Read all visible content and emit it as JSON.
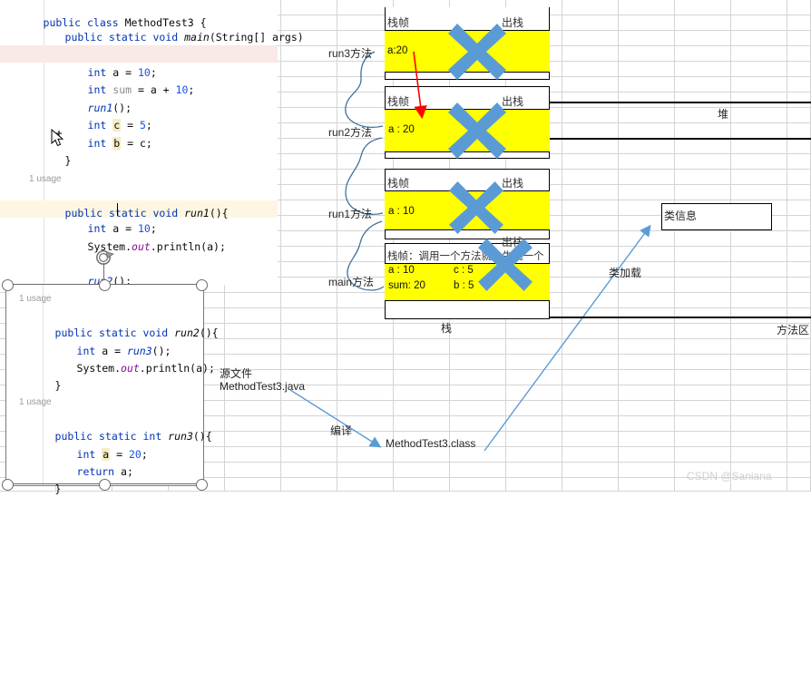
{
  "editor": {
    "top_lines": [
      "public class MethodTest3 {",
      "public static void main(String[] args)",
      "int a = 10;",
      "int sum = a + 10;",
      "run1();",
      "int c = 5;",
      "int b = c;",
      "}",
      "1 usage",
      "public static void run1(){",
      "int a = 10;",
      "System.out.println(a);",
      "run2();",
      "}"
    ],
    "bottom_lines": [
      "1 usage",
      "public static void run2(){",
      "int a = run3();",
      "System.out.println(a);",
      "}",
      "1 usage",
      "public static int run3(){",
      "int a = 20;",
      "return a;",
      "}"
    ],
    "tokens": {
      "public": "public",
      "class": "class",
      "static": "static",
      "void": "void",
      "int": "int",
      "return": "return",
      "usage": "1 usage",
      "class_name": "MethodTest3",
      "main_sig": "main(String[] args)",
      "args_type": "String[]",
      "run1_call": "run1();",
      "run2_call": "run2();",
      "run3_call": "run3();",
      "sysout": "System.out.println(a);",
      "a_10": "int a = 10;",
      "a_20": "int a = 20;",
      "sum_line": "int sum = a + 10;",
      "c_line": "int c = 5;",
      "b_line": "int b = c;",
      "return_a": "return a;",
      "brace_close": "}",
      "run1_def": "public static void run1(){",
      "run2_def": "public static void run2(){",
      "run3_def": "public static int run3(){",
      "a_run3": "int a = run3();"
    }
  },
  "stack": {
    "area_label": "栈",
    "frames": [
      {
        "name": "run3方法",
        "header": "栈帧",
        "pop": "出栈",
        "vars": [
          "a:20"
        ]
      },
      {
        "name": "run2方法",
        "header": "栈帧",
        "pop": "出栈",
        "vars": [
          "a : 20"
        ]
      },
      {
        "name": "run1方法",
        "header": "栈帧",
        "pop": "出栈",
        "vars": [
          "a : 10"
        ]
      },
      {
        "name": "main方法",
        "header": "栈帧：调用一个方法就会生成一个",
        "pop": "出栈",
        "vars": [
          "a : 10",
          "c : 5",
          "sum: 20",
          "b : 5"
        ]
      }
    ],
    "x_icon": "blue-cross-icon"
  },
  "heap": {
    "label": "堆"
  },
  "method_area": {
    "label": "方法区",
    "class_info": "类信息",
    "class_load": "类加载"
  },
  "compile": {
    "source_label": "源文件",
    "source_file": "MethodTest3.java",
    "action": "编译",
    "class_file": "MethodTest3.class"
  },
  "watermark": {
    "text": "CSDN @Saniana"
  },
  "colors": {
    "frame_yellow": "#ffff00",
    "x_blue": "#5b9bd5",
    "arrow_red": "#ff0000",
    "arrow_blue": "#5b9bd5",
    "curve_blue": "#41719c",
    "grid": "#d4d4d4",
    "keyword": "#0033b3",
    "number": "#1750eb",
    "field": "#871094",
    "hl_pink": "#fbe9e7",
    "hl_yellow": "#fdf6e3"
  }
}
